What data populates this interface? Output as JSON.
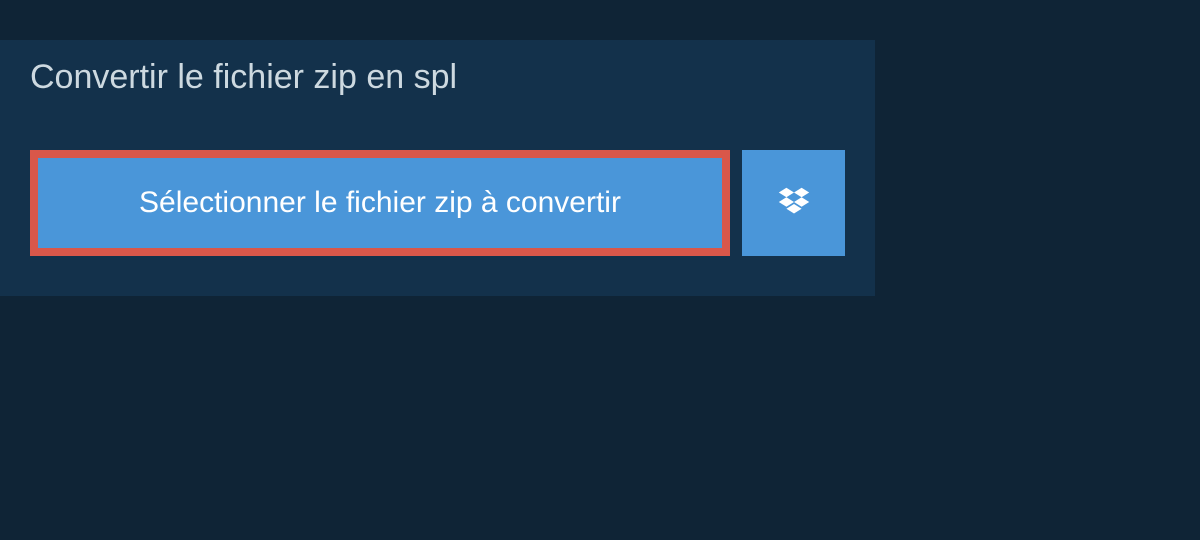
{
  "title": "Convertir le fichier zip en spl",
  "select_button_label": "Sélectionner le fichier zip à convertir",
  "colors": {
    "page_bg": "#0f2436",
    "panel_bg": "#13314b",
    "button_bg": "#4a96d9",
    "highlight_border": "#d9574a",
    "text_light": "#cdd9e0",
    "text_white": "#ffffff"
  }
}
